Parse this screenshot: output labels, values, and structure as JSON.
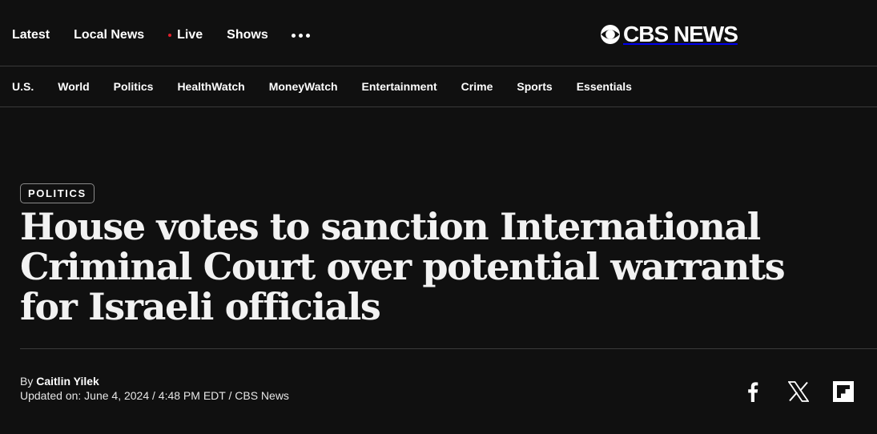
{
  "top_nav": {
    "items": [
      {
        "label": "Latest"
      },
      {
        "label": "Local News"
      },
      {
        "label": "Live",
        "live": true
      },
      {
        "label": "Shows"
      }
    ],
    "more_icon": "more-dots-icon"
  },
  "logo": {
    "text": "CBS NEWS",
    "icon": "cbs-eye-icon"
  },
  "section_nav": {
    "items": [
      {
        "label": "U.S."
      },
      {
        "label": "World"
      },
      {
        "label": "Politics"
      },
      {
        "label": "HealthWatch"
      },
      {
        "label": "MoneyWatch"
      },
      {
        "label": "Entertainment"
      },
      {
        "label": "Crime"
      },
      {
        "label": "Sports"
      },
      {
        "label": "Essentials"
      }
    ]
  },
  "article": {
    "category": "POLITICS",
    "headline": "House votes to sanction International Criminal Court over potential warrants for Israeli officials",
    "byline_prefix": "By",
    "author": "Caitlin Yilek",
    "updated": "Updated on: June 4, 2024 / 4:48 PM EDT / CBS News"
  },
  "share": {
    "icons": [
      "facebook-icon",
      "x-twitter-icon",
      "flipboard-icon"
    ]
  },
  "colors": {
    "background": "#101010",
    "text": "#ffffff",
    "live_dot": "#e0202b",
    "divider": "#3a3a3a"
  }
}
